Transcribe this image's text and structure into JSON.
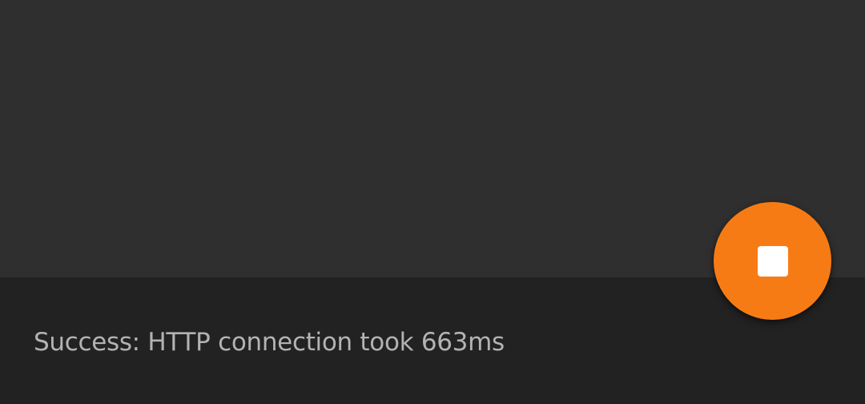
{
  "status": {
    "message": "Success: HTTP connection took 663ms"
  },
  "fab": {
    "icon": "stop-icon",
    "color": "#f77b14",
    "icon_color": "#ffffff"
  },
  "colors": {
    "content_background": "#2f2f2f",
    "status_background": "#222222",
    "status_text": "#b3b3b3"
  }
}
